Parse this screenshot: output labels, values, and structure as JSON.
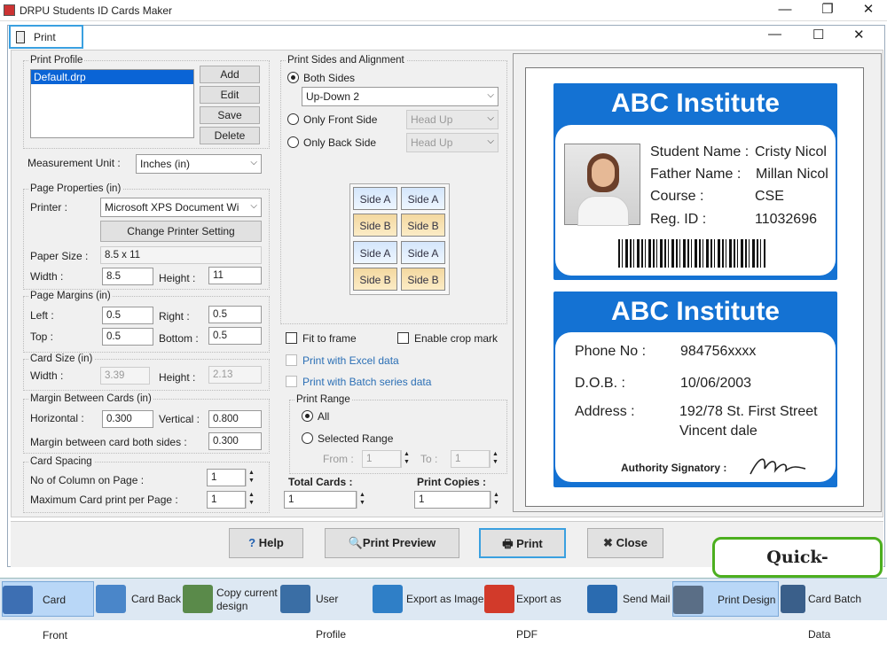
{
  "app": {
    "title": "DRPU Students ID Cards Maker"
  },
  "dialog": {
    "title": "Print"
  },
  "print_profile": {
    "label": "Print Profile",
    "items": [
      "Default.drp"
    ],
    "add": "Add",
    "edit": "Edit",
    "save": "Save",
    "delete": "Delete"
  },
  "measurement": {
    "label": "Measurement Unit :",
    "value": "Inches (in)"
  },
  "page_properties": {
    "label": "Page Properties (in)",
    "printer_label": "Printer :",
    "printer_value": "Microsoft XPS Document Wi",
    "change_printer": "Change Printer Setting",
    "paper_size_label": "Paper Size :",
    "paper_size_value": "8.5 x 11",
    "width_label": "Width :",
    "width_value": "8.5",
    "height_label": "Height :",
    "height_value": "11"
  },
  "page_margins": {
    "label": "Page Margins (in)",
    "left_label": "Left :",
    "left_value": "0.5",
    "right_label": "Right :",
    "right_value": "0.5",
    "top_label": "Top :",
    "top_value": "0.5",
    "bottom_label": "Bottom :",
    "bottom_value": "0.5"
  },
  "card_size": {
    "label": "Card Size (in)",
    "width_label": "Width :",
    "width_value": "3.39",
    "height_label": "Height :",
    "height_value": "2.13"
  },
  "margin_between": {
    "label": "Margin Between Cards (in)",
    "horizontal_label": "Horizontal :",
    "horizontal_value": "0.300",
    "vertical_label": "Vertical :",
    "vertical_value": "0.800",
    "both_label": "Margin between card both sides :",
    "both_value": "0.300"
  },
  "card_spacing": {
    "label": "Card Spacing",
    "columns_label": "No of Column on Page :",
    "columns_value": "1",
    "max_label": "Maximum Card print per Page :",
    "max_value": "1"
  },
  "sides": {
    "label": "Print Sides and Alignment",
    "both": "Both Sides",
    "both_select": "Up-Down 2",
    "front": "Only Front Side",
    "front_select": "Head Up",
    "back": "Only Back Side",
    "back_select": "Head Up",
    "side_a": "Side A",
    "side_b": "Side B"
  },
  "options": {
    "fit_to_frame": "Fit to frame",
    "crop_mark": "Enable crop mark",
    "excel": "Print with Excel data",
    "batch": "Print with Batch series data"
  },
  "print_range": {
    "label": "Print Range",
    "all": "All",
    "selected": "Selected Range",
    "from_label": "From :",
    "from_value": "1",
    "to_label": "To :",
    "to_value": "1"
  },
  "totals": {
    "total_cards_label": "Total Cards :",
    "total_cards_value": "1",
    "copies_label": "Print Copies :",
    "copies_value": "1"
  },
  "card_front": {
    "institute": "ABC Institute",
    "student_label": "Student Name :",
    "student_value": "Cristy Nicol",
    "father_label": "Father Name :",
    "father_value": "Millan Nicol",
    "course_label": "Course :",
    "course_value": "CSE",
    "reg_label": "Reg. ID :",
    "reg_value": "11032696"
  },
  "card_back": {
    "institute": "ABC Institute",
    "phone_label": "Phone No :",
    "phone_value": "984756xxxx",
    "dob_label": "D.O.B. :",
    "dob_value": "10/06/2003",
    "address_label": "Address :",
    "address_line1": "192/78 St. First Street",
    "address_line2": "Vincent dale",
    "signatory": "Authority Signatory :"
  },
  "actions": {
    "help": "Help",
    "preview": "Print Preview",
    "print": "Print",
    "close": "Close"
  },
  "badge": "Quick-Billing.com",
  "taskbar": {
    "card_front": "Card Front",
    "card_back": "Card Back",
    "copy_design": "Copy current design",
    "user_profile": "User Profile",
    "export_image": "Export as Image",
    "export_pdf": "Export as PDF",
    "send_mail": "Send Mail",
    "print_design": "Print Design",
    "batch_data": "Card Batch Data"
  },
  "colors": {
    "accent": "#1472d3",
    "highlight": "#3aa0e0",
    "badge_border": "#4caf1f"
  }
}
